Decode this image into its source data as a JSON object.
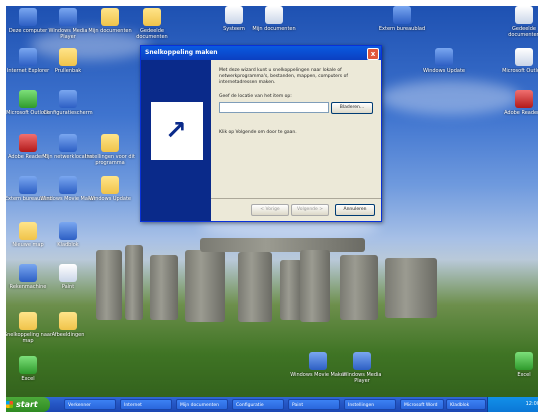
{
  "desktop_icons": [
    {
      "label": "Deze computer"
    },
    {
      "label": "Windows Media Player"
    },
    {
      "label": "Mijn documenten"
    },
    {
      "label": "Gedeelde documenten"
    },
    {
      "label": "Internet Explorer"
    },
    {
      "label": "Prullenbak"
    },
    {
      "label": "Microsoft Outlook"
    },
    {
      "label": "Configuratiescherm"
    },
    {
      "label": "Adobe Reader 8"
    },
    {
      "label": "Mijn netwerklocaties"
    },
    {
      "label": "Instellingen voor dit programma"
    },
    {
      "label": "Extern bureaublad"
    },
    {
      "label": "Windows Movie Maker"
    },
    {
      "label": "Windows Update"
    },
    {
      "label": "Nieuwe map"
    },
    {
      "label": "Kladblok"
    },
    {
      "label": "Rekenmachine"
    },
    {
      "label": "Paint"
    },
    {
      "label": "Snelkoppeling naar map"
    },
    {
      "label": "Afbeeldingen"
    },
    {
      "label": "Excel"
    },
    {
      "label": "Systeem"
    }
  ],
  "dialog": {
    "title": "Snelkoppeling maken",
    "description": "Met deze wizard kunt u snelkoppelingen naar lokale of netwerkprogramma's, bestanden, mappen, computers of internetadressen maken.",
    "location_label": "Geef de locatie van het item op:",
    "location_value": "",
    "browse_label": "Bladeren...",
    "hint": "Klik op Volgende om door te gaan.",
    "back_label": "< Vorige",
    "next_label": "Volgende >",
    "cancel_label": "Annuleren",
    "close_glyph": "x"
  },
  "taskbar": {
    "start_label": "start",
    "tasks": [
      "Verkenner",
      "Internet",
      "Mijn documenten",
      "Configuratie",
      "Paint",
      "Instellingen",
      "Microsoft Word",
      "Kladblok"
    ],
    "clock": "12:00"
  },
  "colors": {
    "titlebar": "#0b3fc1",
    "start_button": "#3c9a2f",
    "close_button": "#e0563a"
  }
}
